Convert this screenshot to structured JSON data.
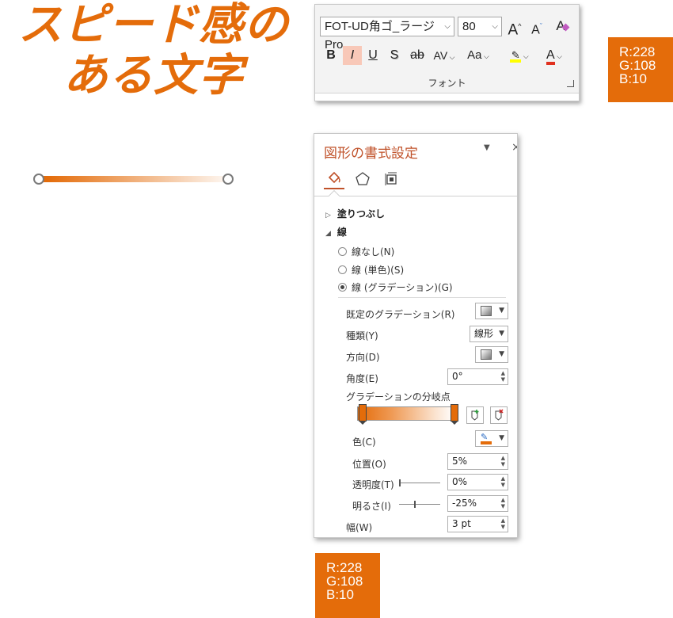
{
  "title": {
    "line1": "スピード感の",
    "line2": "ある文字"
  },
  "colors": {
    "accent": "#e46c0a",
    "pane_title": "#c0522a",
    "highlight_button": "#f8c8b8"
  },
  "ribbon": {
    "font_name": "FOT-UD角ゴ_ラージ Pro",
    "font_size": "80",
    "grow_label": "A",
    "shrink_label": "A",
    "clear_format_label": "A",
    "bold_label": "B",
    "italic_label": "I",
    "underline_label": "U",
    "shadow_label": "S",
    "strike_label": "ab",
    "spacing_label": "AV",
    "case_label": "Aa",
    "font_color_label": "A",
    "group_label": "フォント"
  },
  "swatch_top": {
    "r": "R:228",
    "g": "G:108",
    "b": "B:10"
  },
  "swatch_bottom": {
    "r": "R:228",
    "g": "G:108",
    "b": "B:10"
  },
  "pane": {
    "title": "図形の書式設定",
    "menu_glyph": "▼",
    "close_glyph": "×",
    "tabs": [
      "fill-line",
      "effects",
      "size-properties"
    ],
    "fill_section": "塗りつぶし",
    "line_section": "線",
    "radios": [
      {
        "label": "線なし(N)",
        "selected": false
      },
      {
        "label": "線 (単色)(S)",
        "selected": false
      },
      {
        "label": "線 (グラデーション)(G)",
        "selected": true
      }
    ],
    "preset_label": "既定のグラデーション(R)",
    "type_label": "種類(Y)",
    "type_value": "線形",
    "direction_label": "方向(D)",
    "angle_label": "角度(E)",
    "angle_value": "0°",
    "stops_label": "グラデーションの分岐点",
    "color_label": "色(C)",
    "position_label": "位置(O)",
    "position_value": "5%",
    "transparency_label": "透明度(T)",
    "transparency_value": "0%",
    "brightness_label": "明るさ(I)",
    "brightness_value": "-25%",
    "width_label": "幅(W)",
    "width_value": "3 pt"
  }
}
